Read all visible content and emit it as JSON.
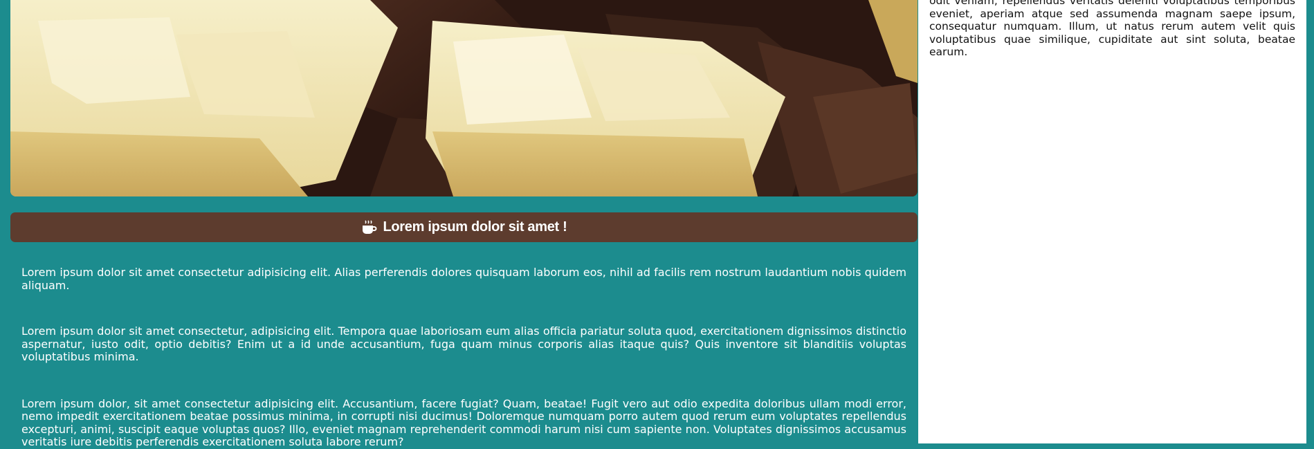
{
  "hero": {
    "image": "white-and-dark-chocolate-bars-photo"
  },
  "banner": {
    "icon": "coffee-cup-icon",
    "title": "Lorem ipsum dolor sit amet !"
  },
  "main": {
    "paragraphs": [
      "Lorem ipsum dolor sit amet consectetur adipisicing elit. Alias perferendis dolores quisquam laborum eos, nihil ad facilis rem nostrum laudantium nobis quidem aliquam.",
      "Lorem ipsum dolor sit amet consectetur, adipisicing elit. Tempora quae laboriosam eum alias officia pariatur soluta quod, exercitationem dignissimos distinctio aspernatur, iusto odit, optio debitis? Enim ut a id unde accusantium, fuga quam minus corporis alias itaque quis? Quis inventore sit blanditiis voluptas voluptatibus minima.",
      "Lorem ipsum dolor, sit amet consectetur adipisicing elit. Accusantium, facere fugiat? Quam, beatae! Fugit vero aut odio expedita doloribus ullam modi error, nemo impedit exercitationem beatae possimus minima, in corrupti nisi ducimus! Doloremque numquam porro autem quod rerum eum voluptates repellendus excepturi, animi, suscipit eaque voluptas quos? Illo, eveniet magnam reprehenderit commodi harum nisi cum sapiente non. Voluptates dignissimos accusamus veritatis iure debitis perferendis exercitationem soluta labore rerum?"
    ]
  },
  "sidebar": {
    "text": "odit veniam, repellendus veritatis deleniti voluptatibus temporibus eveniet, aperiam atque sed assumenda magnam saepe ipsum, consequatur numquam. Illum, ut natus rerum autem velit quis voluptatibus quae similique, cupiditate aut sint soluta, beatae earum."
  },
  "colors": {
    "background": "#1c8c8e",
    "banner": "#5d3c2e",
    "sidebar": "#ffffff"
  }
}
